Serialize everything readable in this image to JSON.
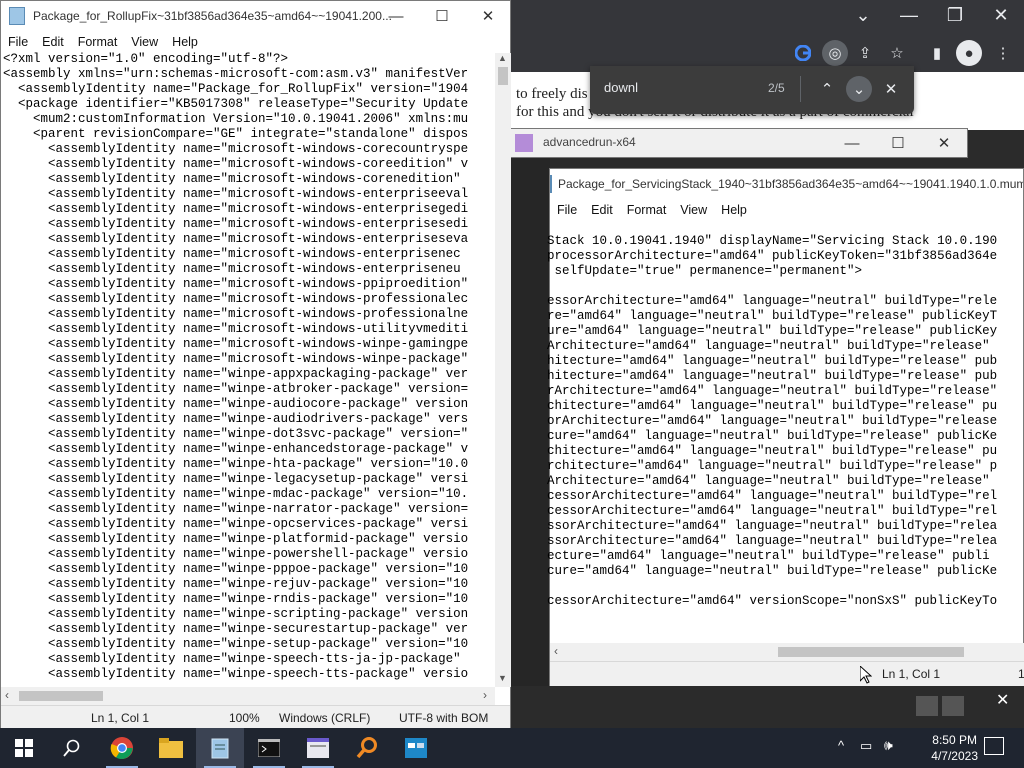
{
  "chrome": {
    "find_query": "downl",
    "find_count": "2/5",
    "page_lines": [
      "to freely dis                                              net, or in",
      "for this and you don't sell it or distribute it as a part of commercial"
    ]
  },
  "adv_window": {
    "title": "advancedrun-x64"
  },
  "notepad_left": {
    "title": "Package_for_RollupFix~31bf3856ad364e35~amd64~~19041.200...",
    "menu": [
      "File",
      "Edit",
      "Format",
      "View",
      "Help"
    ],
    "text_lines": [
      "<?xml version=\"1.0\" encoding=\"utf-8\"?>",
      "<assembly xmlns=\"urn:schemas-microsoft-com:asm.v3\" manifestVer",
      "  <assemblyIdentity name=\"Package_for_RollupFix\" version=\"1904",
      "  <package identifier=\"KB5017308\" releaseType=\"Security Update",
      "    <mum2:customInformation Version=\"10.0.19041.2006\" xmlns:mu",
      "    <parent revisionCompare=\"GE\" integrate=\"standalone\" dispos",
      "      <assemblyIdentity name=\"microsoft-windows-corecountryspe",
      "      <assemblyIdentity name=\"microsoft-windows-coreedition\" v",
      "      <assemblyIdentity name=\"microsoft-windows-corenedition\"",
      "      <assemblyIdentity name=\"microsoft-windows-enterpriseeval",
      "      <assemblyIdentity name=\"microsoft-windows-enterprisegedi",
      "      <assemblyIdentity name=\"microsoft-windows-enterprisesedi",
      "      <assemblyIdentity name=\"microsoft-windows-enterpriseseva",
      "      <assemblyIdentity name=\"microsoft-windows-enterprisenec",
      "      <assemblyIdentity name=\"microsoft-windows-enterpriseneu",
      "      <assemblyIdentity name=\"microsoft-windows-ppiproedition\"",
      "      <assemblyIdentity name=\"microsoft-windows-professionalec",
      "      <assemblyIdentity name=\"microsoft-windows-professionalne",
      "      <assemblyIdentity name=\"microsoft-windows-utilityvmediti",
      "      <assemblyIdentity name=\"microsoft-windows-winpe-gamingpe",
      "      <assemblyIdentity name=\"microsoft-windows-winpe-package\"",
      "      <assemblyIdentity name=\"winpe-appxpackaging-package\" ver",
      "      <assemblyIdentity name=\"winpe-atbroker-package\" version=",
      "      <assemblyIdentity name=\"winpe-audiocore-package\" version",
      "      <assemblyIdentity name=\"winpe-audiodrivers-package\" vers",
      "      <assemblyIdentity name=\"winpe-dot3svc-package\" version=\"",
      "      <assemblyIdentity name=\"winpe-enhancedstorage-package\" v",
      "      <assemblyIdentity name=\"winpe-hta-package\" version=\"10.0",
      "      <assemblyIdentity name=\"winpe-legacysetup-package\" versi",
      "      <assemblyIdentity name=\"winpe-mdac-package\" version=\"10.",
      "      <assemblyIdentity name=\"winpe-narrator-package\" version=",
      "      <assemblyIdentity name=\"winpe-opcservices-package\" versi",
      "      <assemblyIdentity name=\"winpe-platformid-package\" versio",
      "      <assemblyIdentity name=\"winpe-powershell-package\" versio",
      "      <assemblyIdentity name=\"winpe-pppoe-package\" version=\"10",
      "      <assemblyIdentity name=\"winpe-rejuv-package\" version=\"10",
      "      <assemblyIdentity name=\"winpe-rndis-package\" version=\"10",
      "      <assemblyIdentity name=\"winpe-scripting-package\" version",
      "      <assemblyIdentity name=\"winpe-securestartup-package\" ver",
      "      <assemblyIdentity name=\"winpe-setup-package\" version=\"10",
      "      <assemblyIdentity name=\"winpe-speech-tts-ja-jp-package\"",
      "      <assemblyIdentity name=\"winpe-speech-tts-package\" versio"
    ],
    "status": {
      "position": "Ln 1, Col 1",
      "zoom": "100%",
      "line_ending": "Windows (CRLF)",
      "encoding": "UTF-8 with BOM"
    }
  },
  "notepad_right": {
    "title": "Package_for_ServicingStack_1940~31bf3856ad364e35~amd64~~19041.1940.1.0.mum",
    "menu": [
      "File",
      "Edit",
      "Format",
      "View",
      "Help"
    ],
    "text_lines": [
      "Stack 10.0.19041.1940\" displayName=\"Servicing Stack 10.0.190",
      "processorArchitecture=\"amd64\" publicKeyToken=\"31bf3856ad364e",
      " selfUpdate=\"true\" permanence=\"permanent\">",
      "",
      "essorArchitecture=\"amd64\" language=\"neutral\" buildType=\"rele",
      "re=\"amd64\" language=\"neutral\" buildType=\"release\" publicKeyT",
      "ure=\"amd64\" language=\"neutral\" buildType=\"release\" publicKey",
      "Architecture=\"amd64\" language=\"neutral\" buildType=\"release\"",
      "hitecture=\"amd64\" language=\"neutral\" buildType=\"release\" pub",
      "hitecture=\"amd64\" language=\"neutral\" buildType=\"release\" pub",
      "rArchitecture=\"amd64\" language=\"neutral\" buildType=\"release\"",
      "chitecture=\"amd64\" language=\"neutral\" buildType=\"release\" pu",
      "orArchitecture=\"amd64\" language=\"neutral\" buildType=\"release",
      "cure=\"amd64\" language=\"neutral\" buildType=\"release\" publicKe",
      "chitecture=\"amd64\" language=\"neutral\" buildType=\"release\" pu",
      "rchitecture=\"amd64\" language=\"neutral\" buildType=\"release\" p",
      "Architecture=\"amd64\" language=\"neutral\" buildType=\"release\"",
      "cessorArchitecture=\"amd64\" language=\"neutral\" buildType=\"rel",
      "cessorArchitecture=\"amd64\" language=\"neutral\" buildType=\"rel",
      "ssorArchitecture=\"amd64\" language=\"neutral\" buildType=\"relea",
      "ssorArchitecture=\"amd64\" language=\"neutral\" buildType=\"relea",
      "ecture=\"amd64\" language=\"neutral\" buildType=\"release\" publi",
      "cure=\"amd64\" language=\"neutral\" buildType=\"release\" publicKe",
      "",
      "cessorArchitecture=\"amd64\" versionScope=\"nonSxS\" publicKeyTo"
    ],
    "status": {
      "position": "Ln 1, Col 1",
      "extra": "1"
    }
  },
  "taskbar": {
    "time": "8:50 PM",
    "date": "4/7/2023"
  },
  "colors": {
    "accent": "#0078d7",
    "taskbar": "#1f2530",
    "chrome_dark": "#35363a"
  }
}
